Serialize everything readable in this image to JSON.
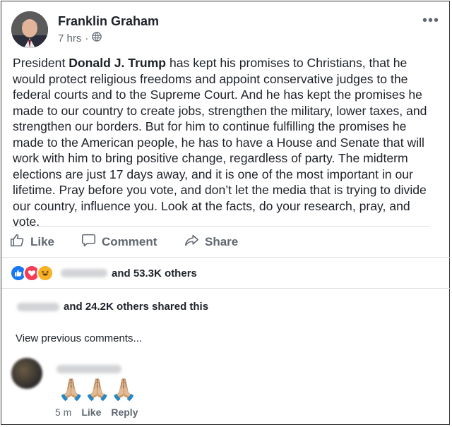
{
  "post": {
    "author": "Franklin Graham",
    "time": "7 hrs",
    "visibility_icon": "globe-icon",
    "more_icon": "ellipsis-icon",
    "text_before": "President ",
    "text_bold": "Donald J. Trump",
    "text_after": " has kept his promises to Christians, that he would protect religious freedoms and appoint conservative judges to the federal courts and to the Supreme Court. And he has kept the promises he made to our country to create jobs, strengthen the military, lower taxes, and strengthen our borders. But for him to continue fulfilling the promises he made to the American people, he has to have a House and Senate that will work with him to bring positive change, regardless of party. The midterm elections are just 17 days away, and it is one of the most important in our lifetime. Pray before you vote, and don’t let the media that is trying to divide our country, influence you. Look at the facts, do your research, pray, and vote."
  },
  "actions": {
    "like": "Like",
    "comment": "Comment",
    "share": "Share"
  },
  "reactions": {
    "icons": [
      "like-reaction-icon",
      "love-reaction-icon",
      "haha-reaction-icon"
    ],
    "summary": "and 53.3K others"
  },
  "shares": {
    "summary": "and 24.2K others shared this"
  },
  "comments": {
    "view_previous": "View previous comments...",
    "items": [
      {
        "emoji": "🙏🏼🙏🏼🙏🏼",
        "time": "5 m",
        "like": "Like",
        "reply": "Reply"
      }
    ]
  },
  "colors": {
    "like_blue": "#1877f2",
    "love_red": "#f33e58",
    "haha_yellow": "#f7b125",
    "text_dark": "#1d2129",
    "text_gray": "#606770"
  }
}
